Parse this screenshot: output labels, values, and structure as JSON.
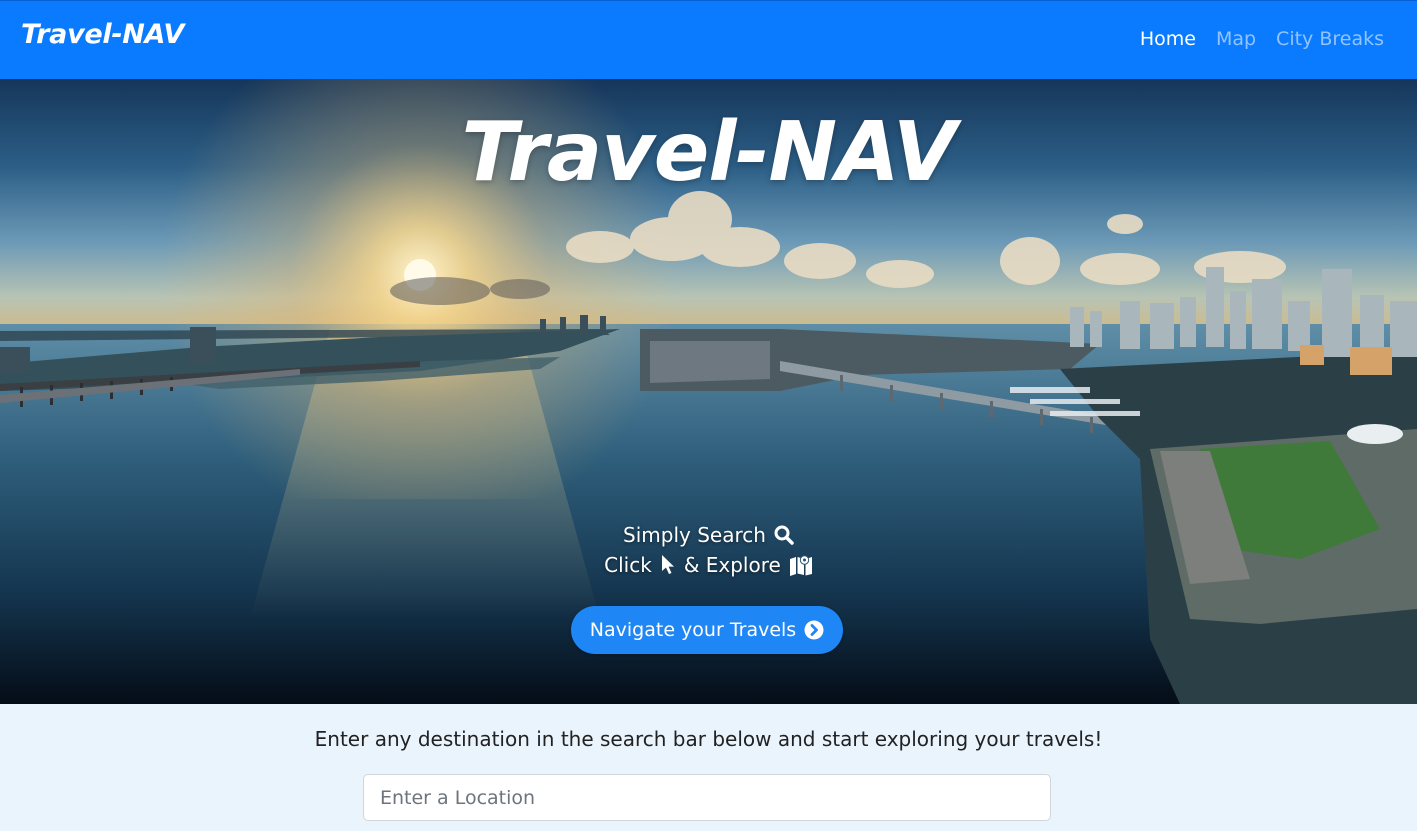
{
  "navbar": {
    "brand": "Travel-NAV",
    "links": [
      "Home",
      "Map",
      "City Breaks"
    ],
    "active": "Home",
    "color": "#0a7bff"
  },
  "hero": {
    "title": "Travel-NAV",
    "line1_text": "Simply Search",
    "line1_icon": "search-icon",
    "line2_text_a": "Click",
    "line2_icon_a": "mouse-pointer-icon",
    "line2_text_b": "& Explore",
    "line2_icon_b": "map-icon",
    "cta_label": "Navigate your Travels",
    "cta_icon": "chevron-circle-right-icon",
    "cta_color": "#1f86f5"
  },
  "intro": {
    "text": "Enter any destination in the search bar below and start exploring your travels!"
  },
  "search": {
    "value": "",
    "placeholder": "Enter a Location"
  }
}
